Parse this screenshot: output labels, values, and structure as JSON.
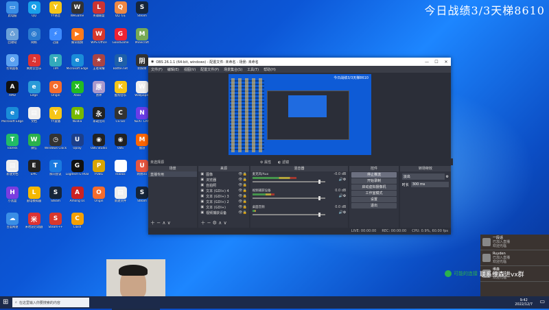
{
  "overlay": {
    "stream_text": "今日战绩3/3天梯8610"
  },
  "desktop_icons": [
    {
      "label": "此电脑",
      "color": "#3a8ee6",
      "glyph": "▭"
    },
    {
      "label": "QQ",
      "color": "#1aa0ea",
      "glyph": "Q"
    },
    {
      "label": "YY语音",
      "color": "#f5c518",
      "glyph": "Y"
    },
    {
      "label": "WeGame",
      "color": "#333",
      "glyph": "W"
    },
    {
      "label": "英雄联盟",
      "color": "#c33",
      "glyph": "L"
    },
    {
      "label": "QQ飞车",
      "color": "#e84",
      "glyph": "Q"
    },
    {
      "label": "Steam",
      "color": "#16253a",
      "glyph": "S"
    },
    {
      "label": "回收站",
      "color": "#6aa0d8",
      "glyph": "♺"
    },
    {
      "label": "网络",
      "color": "#2a7ad0",
      "glyph": "◎"
    },
    {
      "label": "迅雷",
      "color": "#3d8bff",
      "glyph": "⚡"
    },
    {
      "label": "腾讯视频",
      "color": "#ff7a1a",
      "glyph": "▶"
    },
    {
      "label": "WPS Office",
      "color": "#d8382d",
      "glyph": "W"
    },
    {
      "label": "GoodGame",
      "color": "#e23",
      "glyph": "G"
    },
    {
      "label": "Minecraft",
      "color": "#7a5",
      "glyph": "M"
    },
    {
      "label": "控制面板",
      "color": "#5aa0f0",
      "glyph": "⚙"
    },
    {
      "label": "网易云音乐",
      "color": "#d33",
      "glyph": "♫"
    },
    {
      "label": "TIM",
      "color": "#3ab",
      "glyph": "T"
    },
    {
      "label": "Microsoft Edge",
      "color": "#1a8cd8",
      "glyph": "e"
    },
    {
      "label": "王者荣耀",
      "color": "#a44",
      "glyph": "★"
    },
    {
      "label": "Battle.net",
      "color": "#1e5fa8",
      "glyph": "B"
    },
    {
      "label": "阴阳师",
      "color": "#333",
      "glyph": "阴"
    },
    {
      "label": "AMD",
      "color": "#111",
      "glyph": "A"
    },
    {
      "label": "Edge",
      "color": "#2a9ad8",
      "glyph": "e"
    },
    {
      "label": "Origin",
      "color": "#f56c2d",
      "glyph": "O"
    },
    {
      "label": "Xbox",
      "color": "#2b2",
      "glyph": "X"
    },
    {
      "label": "原神",
      "color": "#a9c",
      "glyph": "原"
    },
    {
      "label": "酷狗音乐",
      "color": "#f5c518",
      "glyph": "K"
    },
    {
      "label": "Wallpaper",
      "color": "#eee",
      "glyph": "W"
    },
    {
      "label": "Microsoft Edge",
      "color": "#1a8cd8",
      "glyph": "e"
    },
    {
      "label": "文档",
      "color": "#eee",
      "glyph": "▤"
    },
    {
      "label": "YY直播",
      "color": "#f5c518",
      "glyph": "Y"
    },
    {
      "label": "Nvidia",
      "color": "#76b900",
      "glyph": "N"
    },
    {
      "label": "永劫无间",
      "color": "#222",
      "glyph": "永"
    },
    {
      "label": "CS:GO",
      "color": "#333",
      "glyph": "C"
    },
    {
      "label": "NZXT CAM",
      "color": "#6a3de8",
      "glyph": "N"
    },
    {
      "label": "ToDesk",
      "color": "#2b6",
      "glyph": "T"
    },
    {
      "label": "微信",
      "color": "#2bb24c",
      "glyph": "W"
    },
    {
      "label": "Windows Clock",
      "color": "#333",
      "glyph": "◷"
    },
    {
      "label": "Uplay",
      "color": "#1c3f8a",
      "glyph": "U"
    },
    {
      "label": "OBS Studio",
      "color": "#222",
      "glyph": "◉"
    },
    {
      "label": "OBS",
      "color": "#222",
      "glyph": "◉"
    },
    {
      "label": "傲游",
      "color": "#f60",
      "glyph": "M"
    },
    {
      "label": "新建文档",
      "color": "#eee",
      "glyph": "▤"
    },
    {
      "label": "EPIC",
      "color": "#222",
      "glyph": "E"
    },
    {
      "label": "腾讯会议",
      "color": "#1a7ae0",
      "glyph": "T"
    },
    {
      "label": "Logitech G HUB",
      "color": "#111",
      "glyph": "G"
    },
    {
      "label": "PUBG",
      "color": "#d9a400",
      "glyph": "P"
    },
    {
      "label": "Roblox",
      "color": "#fff",
      "glyph": "R"
    },
    {
      "label": "网易UU",
      "color": "#e8563f",
      "glyph": "U"
    },
    {
      "label": "小黑盒",
      "color": "#7a3de0",
      "glyph": "H"
    },
    {
      "label": "雷电模拟器",
      "color": "#f5b800",
      "glyph": "L"
    },
    {
      "label": "Steam",
      "color": "#16253a",
      "glyph": "S"
    },
    {
      "label": "Among Us",
      "color": "#c22",
      "glyph": "A"
    },
    {
      "label": "Origin",
      "color": "#f56c2d",
      "glyph": "O"
    },
    {
      "label": "新建文件",
      "color": "#eee",
      "glyph": "▤"
    },
    {
      "label": "Steam",
      "color": "#16253a",
      "glyph": "S"
    },
    {
      "label": "百度网盘",
      "color": "#3a8ee6",
      "glyph": "☁"
    },
    {
      "label": "米哈游启动器",
      "color": "#d33",
      "glyph": "米"
    },
    {
      "label": "Steam++",
      "color": "#d8382d",
      "glyph": "S"
    },
    {
      "label": "Clash",
      "color": "#f5a000",
      "glyph": "C"
    }
  ],
  "obs": {
    "title": "OBS 26.1.1 (64-bit, windows) - 配置文件: 未命名 - 场景: 未命名",
    "menu": [
      "文件(F)",
      "编辑(E)",
      "视图(V)",
      "配置文件(P)",
      "场景集合(S)",
      "工具(T)",
      "帮助(H)"
    ],
    "no_source_selected": "未选择源",
    "properties_btn": "属性",
    "filters_btn": "滤镜",
    "dock_headers": {
      "scenes": "场景",
      "sources": "来源",
      "mixer": "混音器",
      "controls": "控件",
      "transitions": "转场特效"
    },
    "scenes": [
      "直播专用"
    ],
    "sources": [
      "图像",
      "浏览器",
      "自拍照",
      "文本 (GDI+) 4",
      "文本 (GDI+) 3",
      "文本 (GDI+) 2",
      "文本 (GDI+)",
      "视频捕获设备"
    ],
    "mixer": [
      {
        "name": "麦克风/Aux",
        "db": "-0.0 dB",
        "level": 0.6,
        "fader": 0.92
      },
      {
        "name": "视频捕获设备",
        "db": "0.0 dB",
        "level": 0.3,
        "fader": 0.92
      },
      {
        "name": "桌面音频",
        "db": "0.0 dB",
        "level": 0.0,
        "fader": 0.92
      }
    ],
    "controls": [
      "停止推流",
      "开始录制",
      "启动虚拟摄像机",
      "工作室模式",
      "设置",
      "退出"
    ],
    "transition": {
      "type": "淡出",
      "duration_label": "时长",
      "duration_value": "300 ms"
    },
    "status": {
      "live": "LIVE: 00:00:00",
      "rec": "REC: 00:00:00",
      "cpu": "CPU: 0.9%, 60.00 fps"
    }
  },
  "taskbar": {
    "search_placeholder": "在这里输入你要搜索的内容",
    "time": "9:42",
    "date": "2022/12/7"
  },
  "wechat_overlay": {
    "label": "联系维森进vx群",
    "prefix": "可能的连接"
  },
  "chat_panel": {
    "items": [
      {
        "name": "一段话",
        "line1": "已加入直播",
        "line2": "欢迎光临"
      },
      {
        "name": "Ruyden",
        "line1": "已加入直播",
        "line2": "欢迎光临"
      },
      {
        "name": "维森",
        "line1": "感谢分享",
        "line2": "欢迎光临"
      }
    ]
  }
}
